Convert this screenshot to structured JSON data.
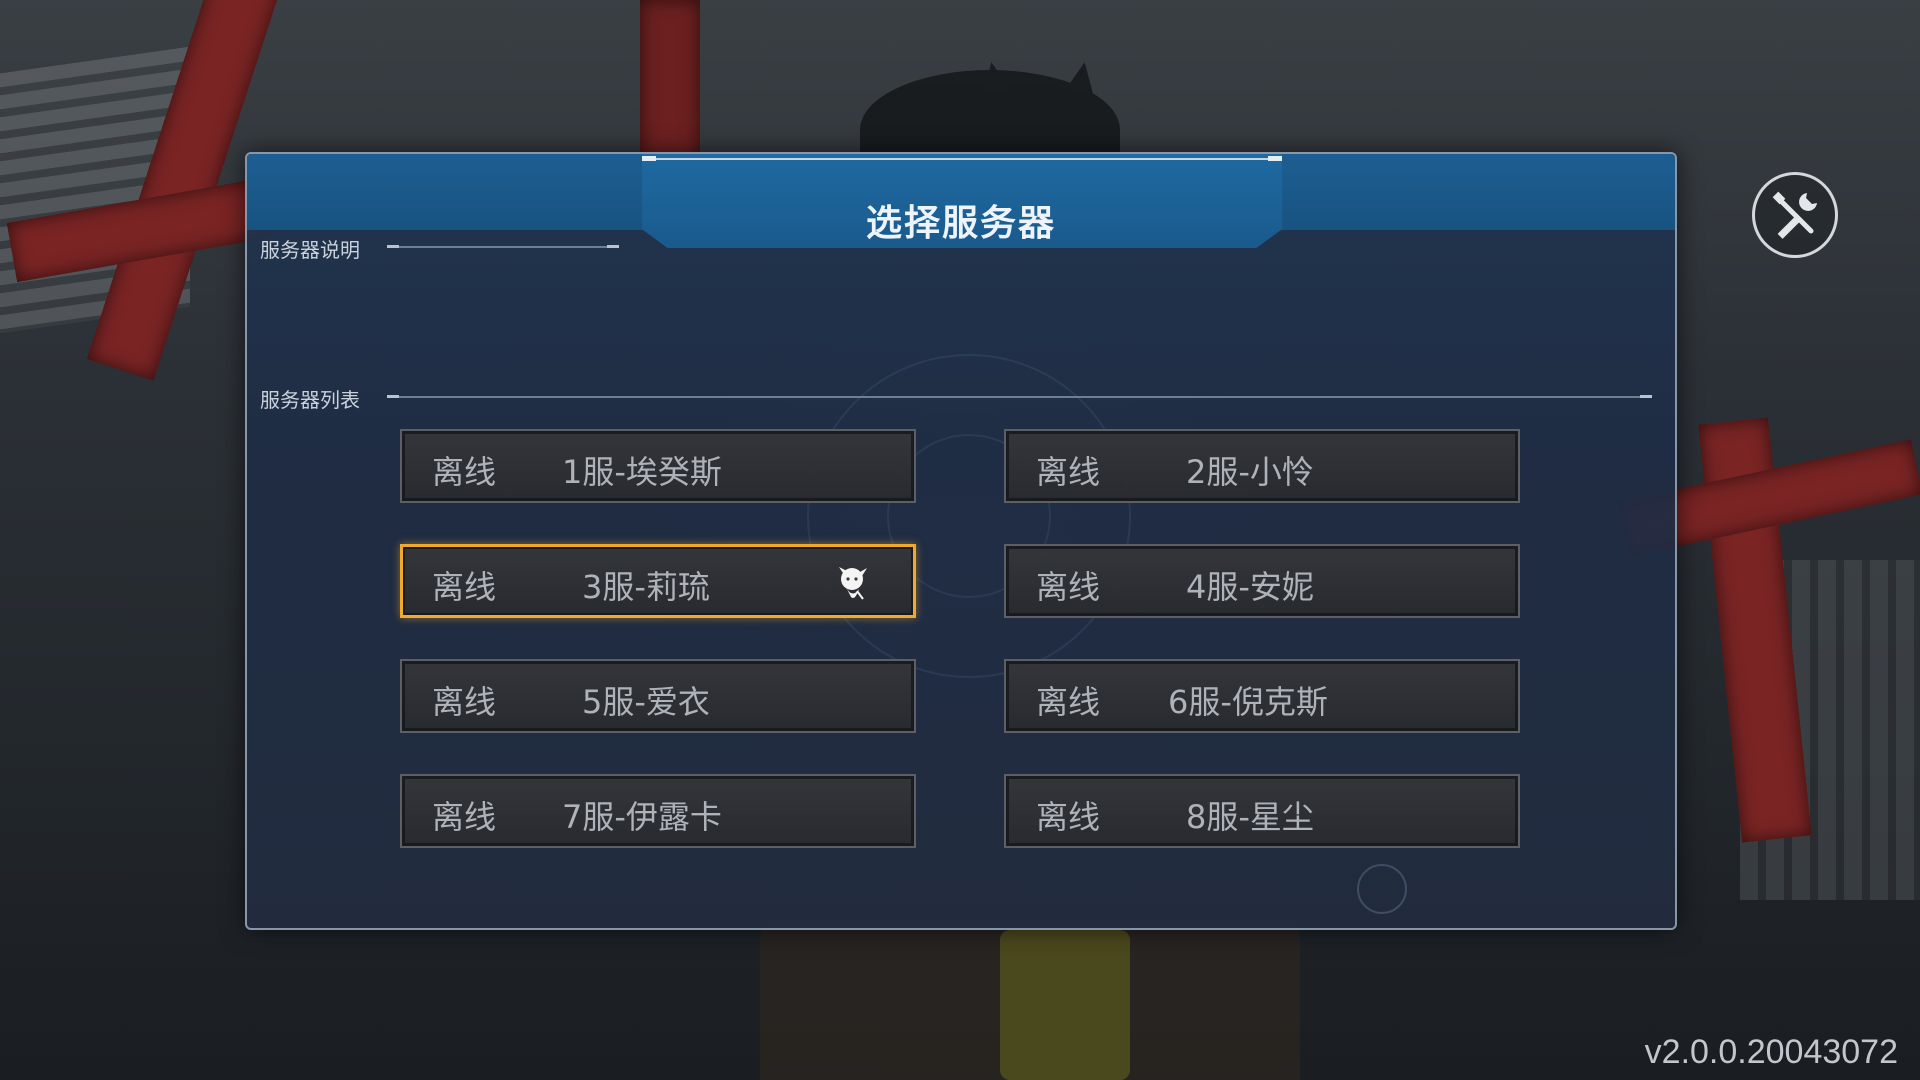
{
  "dialog": {
    "title": "选择服务器",
    "description_label": "服务器说明",
    "list_label": "服务器列表"
  },
  "servers": [
    {
      "status": "离线",
      "name": "1服-埃癸斯",
      "selected": false
    },
    {
      "status": "离线",
      "name": "2服-小怜",
      "selected": false
    },
    {
      "status": "离线",
      "name": "3服-莉琉",
      "selected": true
    },
    {
      "status": "离线",
      "name": "4服-安妮",
      "selected": false
    },
    {
      "status": "离线",
      "name": "5服-爱衣",
      "selected": false
    },
    {
      "status": "离线",
      "name": "6服-倪克斯",
      "selected": false
    },
    {
      "status": "离线",
      "name": "7服-伊露卡",
      "selected": false
    },
    {
      "status": "离线",
      "name": "8服-星尘",
      "selected": false
    }
  ],
  "selected_badge_icon": "character-chibi-icon",
  "tools_icon": "wrench-screwdriver-icon",
  "version": "v2.0.0.20043072",
  "colors": {
    "header_blue": "#1d5e92",
    "selected_border": "#f0a92a",
    "button_text": "#aeb3ba"
  }
}
